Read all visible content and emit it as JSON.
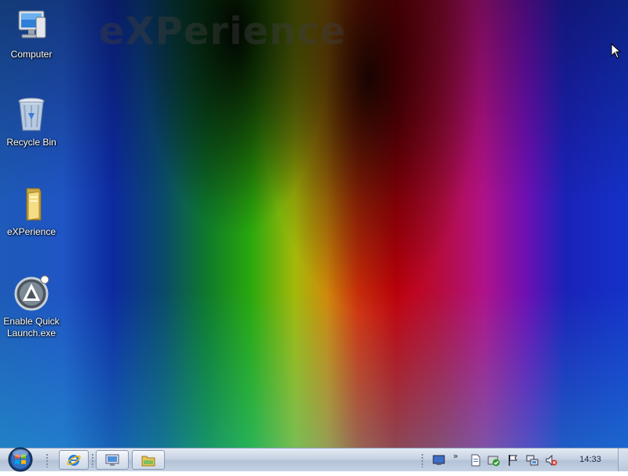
{
  "desktop": {
    "watermark": "eXPerience",
    "icons": [
      {
        "label": "Computer",
        "icon": "computer-icon"
      },
      {
        "label": "Recycle Bin",
        "icon": "recycle-bin-icon"
      },
      {
        "label": "eXPerience",
        "icon": "folder-icon"
      },
      {
        "label": "Enable Quick Launch.exe",
        "icon": "quick-launch-app-icon"
      }
    ]
  },
  "taskbar": {
    "start": "start-orb-icon",
    "quick_launch": [
      "internet-explorer-icon",
      "network-window-icon",
      "folder-window-icon"
    ],
    "tray": {
      "overflow": "»",
      "icons": [
        "desktop-toolbar-icon",
        "document-icon",
        "security-check-icon",
        "action-center-flag-icon",
        "network-icon",
        "volume-muted-icon"
      ],
      "clock": "14:33"
    }
  },
  "colors": {
    "taskbar": "#c7d2e2",
    "label_text": "#ffffff"
  }
}
